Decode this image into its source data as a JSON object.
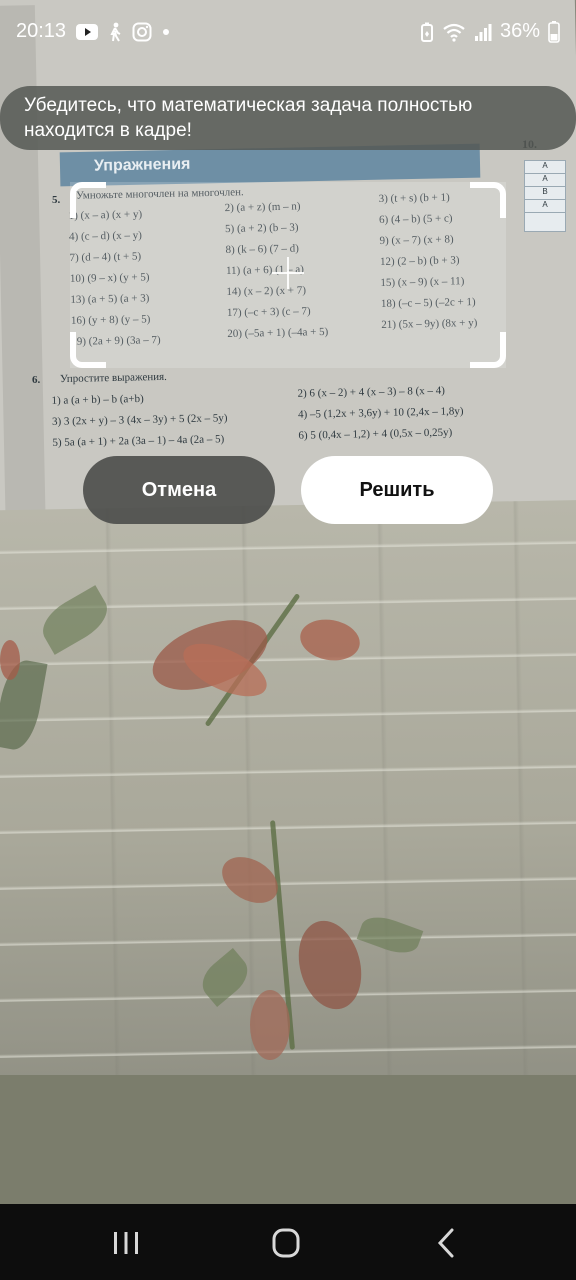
{
  "status_bar": {
    "time": "20:13",
    "battery_percent": "36%",
    "left_icons": [
      "youtube-icon",
      "walking-icon",
      "instagram-icon",
      "dot-icon"
    ],
    "right_icons": [
      "battery-saver-icon",
      "wifi-icon",
      "signal-icon",
      "battery-icon"
    ]
  },
  "toast": {
    "message": "Убедитесь, что математическая задача полностью находится в кадре!"
  },
  "textbook": {
    "header_text": "Упражнения",
    "exercise_5_number": "5.",
    "exercise_5_title": "Умножьте многочлен на многочлен.",
    "exercise_5_col1": [
      "1) (x – a) (x + y)",
      "4) (c – d) (x – y)",
      "7) (d – 4) (t + 5)",
      "10) (9 – x) (y + 5)",
      "13) (a + 5) (a + 3)",
      "16) (y + 8) (y – 5)",
      "19) (2a + 9) (3a – 7)"
    ],
    "exercise_5_col2": [
      "2) (a + z) (m – n)",
      "5) (a + 2) (b – 3)",
      "8) (k – 6) (7 – d)",
      "11) (a + 6) (1 – a)",
      "14) (x – 2) (x + 7)",
      "17) (–c + 3) (c – 7)",
      "20) (–5a + 1) (–4a + 5)"
    ],
    "exercise_5_col3": [
      "3) (t + s) (b + 1)",
      "6) (4 – b) (5 + c)",
      "9) (x – 7) (x + 8)",
      "12) (2 – b) (b + 3)",
      "15) (x – 9) (x – 11)",
      "18) (–c – 5) (–2c + 1)",
      "21) (5x – 9y) (8x + y)"
    ],
    "exercise_6_number": "6.",
    "exercise_6_title": "Упростите выражения.",
    "exercise_6_left": [
      "1) a (a + b) – b (a+b)",
      "3) 3 (2x + y) – 3 (4x – 3y) + 5 (2x – 5y)",
      "5) 5a (a + 1) + 2a (3a – 1) – 4a (2a – 5)"
    ],
    "exercise_6_right": [
      "2) 6 (x – 2) + 4 (x – 3) – 8 (x – 4)",
      "4) –5 (1,2x + 3,6y) + 10 (2,4x – 1,8y)",
      "6) 5 (0,4x – 1,2) + 4 (0,5x – 0,25y)"
    ],
    "answer_table": [
      "А",
      "А",
      "В",
      "А"
    ],
    "page_marker": "10."
  },
  "buttons": {
    "cancel_label": "Отмена",
    "solve_label": "Решить"
  },
  "nav_bar": {
    "icons": [
      "recent-apps-icon",
      "home-icon",
      "back-icon"
    ]
  }
}
